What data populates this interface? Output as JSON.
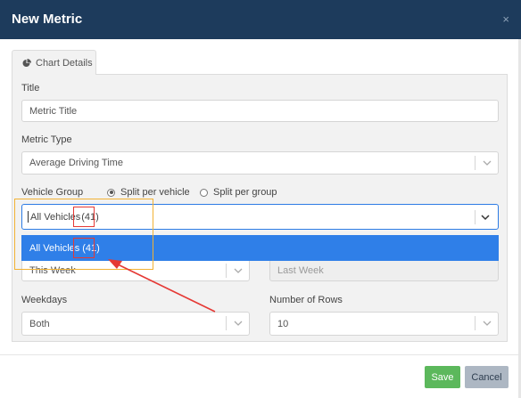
{
  "modal": {
    "title": "New Metric",
    "close": "×"
  },
  "tabs": [
    {
      "label": "Chart Details",
      "icon": "pie-chart-icon"
    }
  ],
  "form": {
    "title_label": "Title",
    "title_value": "Metric Title",
    "metric_type_label": "Metric Type",
    "metric_type_value": "Average Driving Time",
    "vehicle_group_label": "Vehicle Group",
    "split_options": [
      {
        "label": "Split per vehicle",
        "selected": true
      },
      {
        "label": "Split per group",
        "selected": false
      }
    ],
    "vehicle_group_value": "All Vehicles",
    "vehicle_group_count": "(41)",
    "dropdown_option_label": "All Vehicles",
    "dropdown_option_count": "(41)",
    "period_value": "This Week",
    "compare_value": "Last Week",
    "weekdays_label": "Weekdays",
    "weekdays_value": "Both",
    "rows_label": "Number of Rows",
    "rows_value": "10"
  },
  "footer": {
    "save_label": "Save",
    "cancel_label": "Cancel"
  },
  "colors": {
    "header": "#1d3b5c",
    "accent": "#2f7fe8",
    "save": "#5cb85c",
    "cancel": "#adb7c3",
    "annotation_red": "#e53935",
    "annotation_yellow": "#f2b233"
  }
}
